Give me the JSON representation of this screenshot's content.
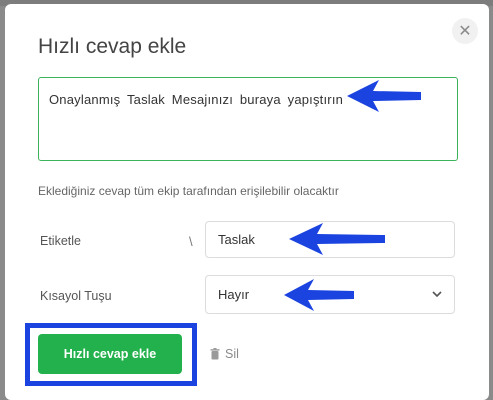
{
  "modal": {
    "title": "Hızlı cevap ekle",
    "close_glyph": "✕",
    "message": "Onaylanmış Taslak Mesajınızı buraya yapıştırın",
    "helper_text": "Eklediğiniz cevap tüm ekip tarafından erişilebilir olacaktır",
    "tag_label": "Etiketle",
    "separator": "\\",
    "tag_value": "Taslak",
    "shortcut_label": "Kısayol Tuşu",
    "shortcut_value": "Hayır",
    "chevron_glyph": "⌄",
    "submit_label": "Hızlı cevap ekle",
    "delete_label": "Sil",
    "delete_glyph": "🗑"
  },
  "colors": {
    "accent_green": "#22b14c",
    "annotation_blue": "#1a43e0"
  }
}
